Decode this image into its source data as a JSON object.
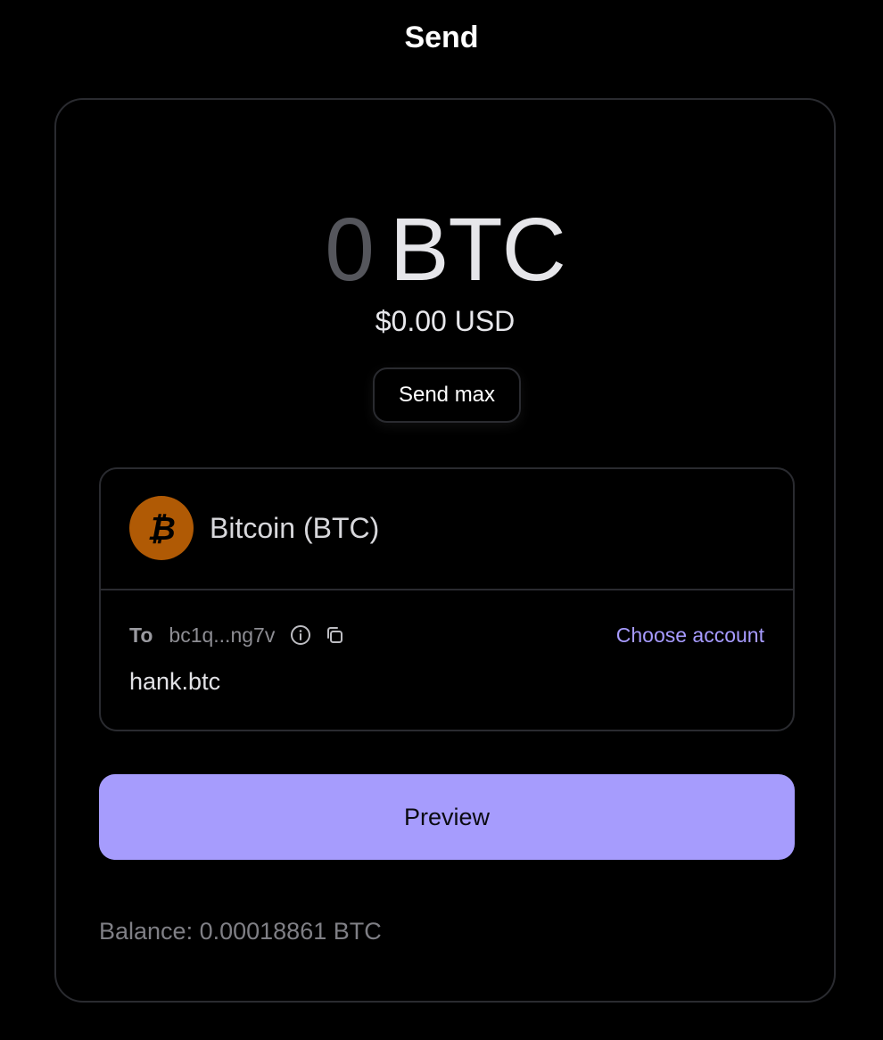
{
  "header": {
    "title": "Send"
  },
  "amount": {
    "value": "0",
    "unit": "BTC",
    "fiat": "$0.00 USD"
  },
  "send_max_label": "Send max",
  "asset": {
    "name": "Bitcoin (BTC)",
    "icon": "bitcoin-icon",
    "icon_color": "#b05a05"
  },
  "recipient": {
    "to_label": "To",
    "address": "bc1q...ng7v",
    "info_icon": "info-icon",
    "copy_icon": "copy-icon",
    "choose_account_label": "Choose account",
    "name": "hank.btc"
  },
  "preview_label": "Preview",
  "balance_text": "Balance: 0.00018861 BTC",
  "colors": {
    "accent": "#a69cfd",
    "link": "#a79bff",
    "background": "#000000"
  }
}
